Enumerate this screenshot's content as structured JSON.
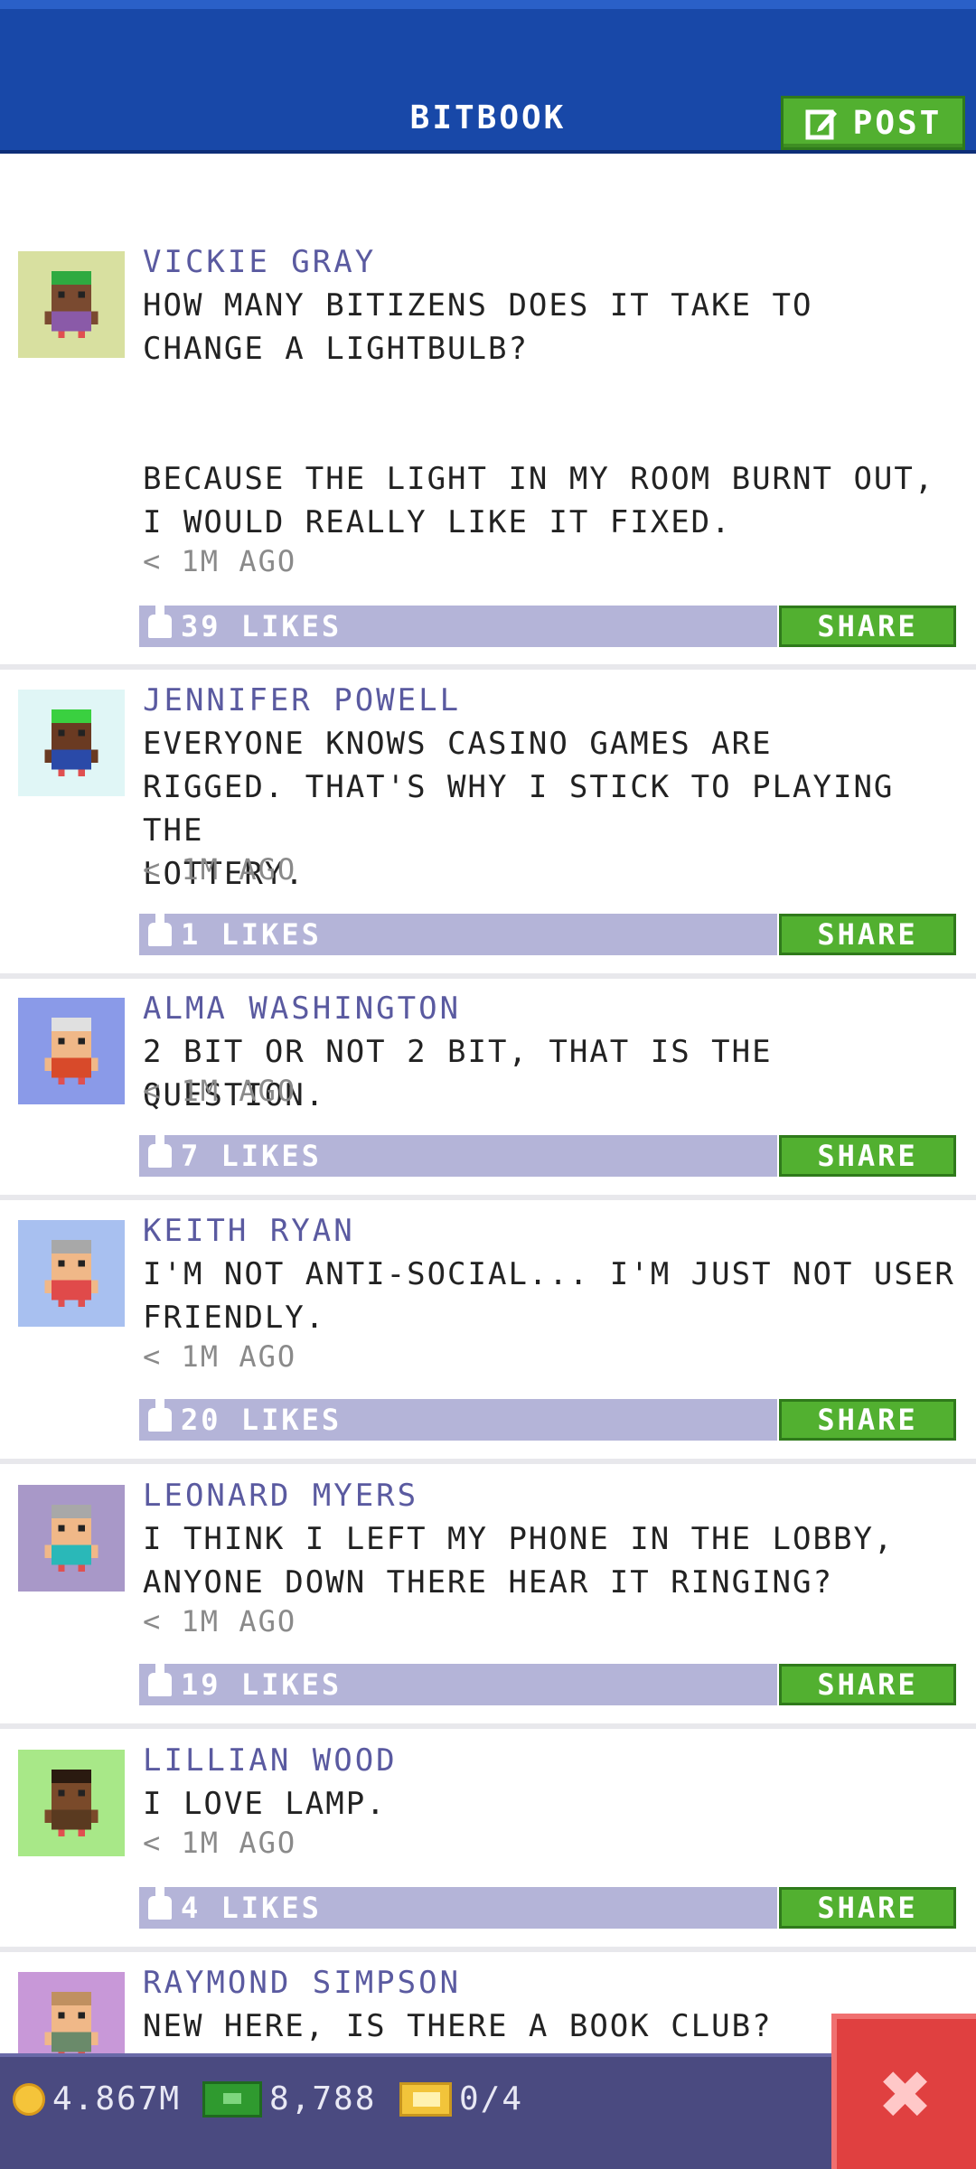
{
  "header": {
    "title": "BITBOOK",
    "post_label": "POST"
  },
  "posts": [
    {
      "name": "VICKIE GRAY",
      "text": "HOW MANY BITIZENS DOES IT TAKE TO\nCHANGE A LIGHTBULB?\n\n\nBECAUSE THE LIGHT IN MY ROOM BURNT OUT,\nI WOULD REALLY LIKE IT FIXED.",
      "time": "< 1M AGO",
      "likes": "39 LIKES",
      "share": "SHARE",
      "avatar_bg": "#d8e0a0",
      "skin": "#7a4a30",
      "hair": "#2faa40",
      "shirt": "#8a5aa8"
    },
    {
      "name": "JENNIFER POWELL",
      "text": "EVERYONE KNOWS CASINO GAMES ARE\nRIGGED. THAT'S WHY I STICK TO PLAYING THE\nLOTTERY.",
      "time": "< 1M AGO",
      "likes": "1 LIKES",
      "share": "SHARE",
      "avatar_bg": "#e0f6f6",
      "skin": "#6a3a22",
      "hair": "#3ad040",
      "shirt": "#2a4aa8"
    },
    {
      "name": "ALMA WASHINGTON",
      "text": "2 BIT OR NOT 2 BIT, THAT IS THE QUESTION.",
      "time": "< 1M AGO",
      "likes": "7 LIKES",
      "share": "SHARE",
      "avatar_bg": "#8a9ae8",
      "skin": "#f0b888",
      "hair": "#e0e0e0",
      "shirt": "#d84a2a"
    },
    {
      "name": "KEITH RYAN",
      "text": "I'M NOT ANTI-SOCIAL... I'M JUST NOT USER\nFRIENDLY.",
      "time": "< 1M AGO",
      "likes": "20 LIKES",
      "share": "SHARE",
      "avatar_bg": "#a8c0f0",
      "skin": "#f0b888",
      "hair": "#a8a8a8",
      "shirt": "#e04a4a"
    },
    {
      "name": "LEONARD MYERS",
      "text": "I THINK I LEFT MY PHONE IN THE LOBBY,\nANYONE DOWN THERE HEAR IT RINGING?",
      "time": "< 1M AGO",
      "likes": "19 LIKES",
      "share": "SHARE",
      "avatar_bg": "#a898c8",
      "skin": "#f0b888",
      "hair": "#a8a8a8",
      "shirt": "#2ab8b8"
    },
    {
      "name": "LILLIAN WOOD",
      "text": "I LOVE LAMP.",
      "time": "< 1M AGO",
      "likes": "4 LIKES",
      "share": "SHARE",
      "avatar_bg": "#a8e888",
      "skin": "#7a4a2a",
      "hair": "#2a1a10",
      "shirt": "#5a3a20"
    },
    {
      "name": "RAYMOND SIMPSON",
      "text": "NEW HERE, IS THERE A BOOK CLUB?",
      "time": "",
      "likes": "",
      "share": "",
      "avatar_bg": "#c898d8",
      "skin": "#f0b888",
      "hair": "#c09060",
      "shirt": "#6a8a6a"
    }
  ],
  "status_bar": {
    "coins": "4.867M",
    "bux": "8,788",
    "tickets": "0/4"
  }
}
